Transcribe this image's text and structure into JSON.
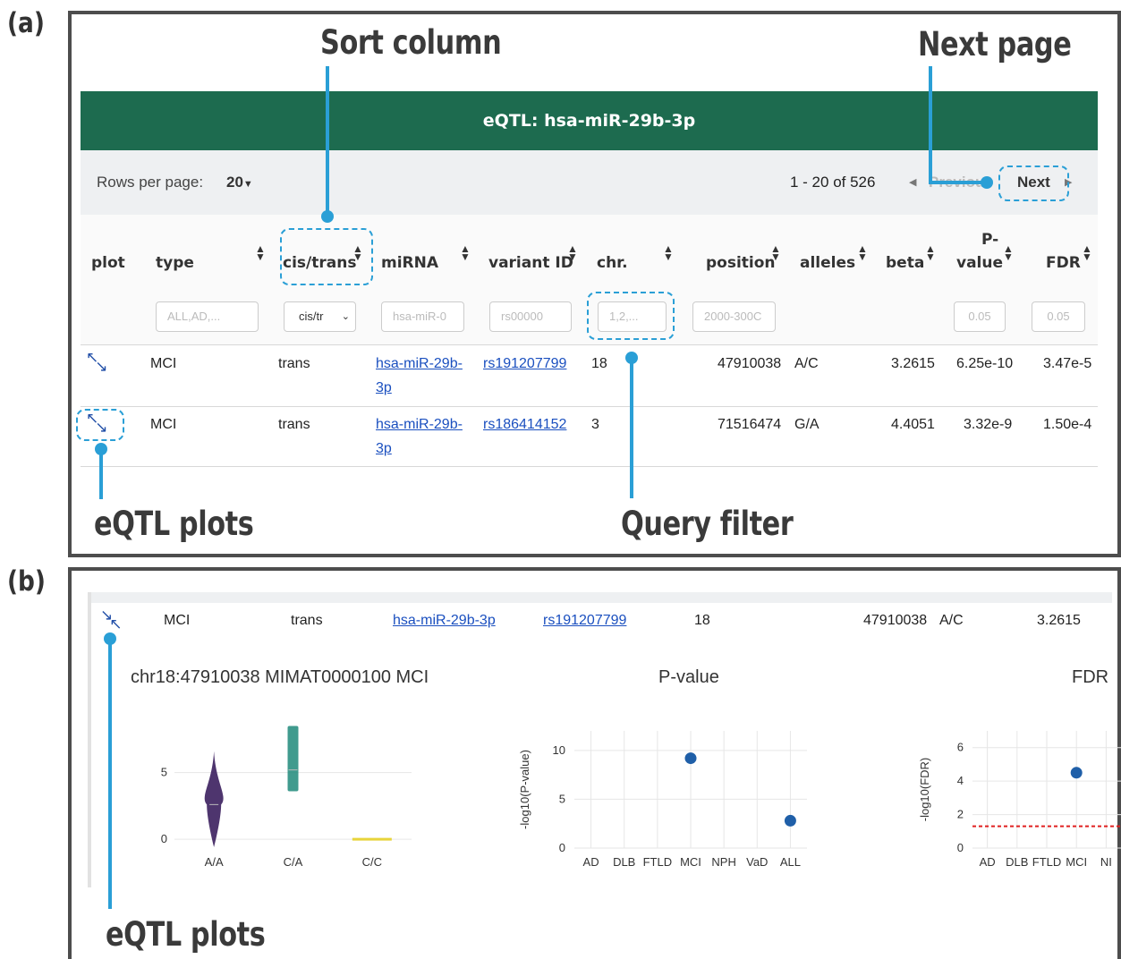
{
  "labels": {
    "panel_a": "(a)",
    "panel_b": "(b)"
  },
  "callouts": {
    "sort_column": "Sort column",
    "next_page": "Next page",
    "eqtl_plots_a": "eQTL plots",
    "query_filter": "Query filter",
    "eqtl_plots_b": "eQTL plots"
  },
  "table": {
    "title": "eQTL: hsa-miR-29b-3p",
    "rows_per_page_label": "Rows per page:",
    "rows_per_page_value": "20",
    "range_text": "1 - 20 of 526",
    "prev_label": "Previous",
    "next_label": "Next",
    "headers": {
      "plot": "plot",
      "type": "type",
      "cis_trans": "cis/trans",
      "mirna": "miRNA",
      "variant_id": "variant ID",
      "chr": "chr.",
      "position": "position",
      "alleles": "alleles",
      "beta": "beta",
      "pvalue_1": "P-",
      "pvalue_2": "value",
      "fdr": "FDR"
    },
    "filters": {
      "type": "ALL,AD,...",
      "cis_trans": "cis/tr",
      "mirna": "hsa-miR-0",
      "variant": "rs00000",
      "chr": "1,2,...",
      "position": "2000-300C",
      "pvalue": "0.05",
      "fdr": "0.05"
    },
    "rows": [
      {
        "type": "MCI",
        "cis": "trans",
        "mirna_1": "hsa-miR-29b-",
        "mirna_2": "3p",
        "variant": "rs191207799",
        "chr": "18",
        "position": "47910038",
        "alleles": "A/C",
        "beta": "3.2615",
        "pvalue": "6.25e-10",
        "fdr": "3.47e-5"
      },
      {
        "type": "MCI",
        "cis": "trans",
        "mirna_1": "hsa-miR-29b-",
        "mirna_2": "3p",
        "variant": "rs186414152",
        "chr": "3",
        "position": "71516474",
        "alleles": "G/A",
        "beta": "4.4051",
        "pvalue": "3.32e-9",
        "fdr": "1.50e-4"
      }
    ]
  },
  "expanded": {
    "row": {
      "type": "MCI",
      "cis": "trans",
      "mirna": "hsa-miR-29b-3p",
      "variant": "rs191207799",
      "chr": "18",
      "position": "47910038",
      "alleles": "A/C",
      "beta": "3.2615"
    },
    "plot_titles": {
      "violin": "chr18:47910038 MIMAT0000100 MCI",
      "pvalue": "P-value",
      "fdr": "FDR"
    }
  },
  "chart_data": [
    {
      "type": "violin",
      "title": "chr18:47910038 MIMAT0000100 MCI",
      "categories": [
        "A/A",
        "C/A",
        "C/C"
      ],
      "yticks": [
        0,
        5
      ],
      "ylim": [
        -0.8,
        8.6
      ],
      "groups": [
        {
          "name": "A/A",
          "min": -0.6,
          "q1": 2.0,
          "median": 2.6,
          "q3": 3.2,
          "max": 6.6,
          "color": "#3b1f5e"
        },
        {
          "name": "C/A",
          "min": 3.6,
          "q1": 3.9,
          "median": 5.2,
          "q3": 8.1,
          "max": 8.5,
          "color": "#1f8a7a"
        },
        {
          "name": "C/C",
          "min": 0.0,
          "q1": 0.0,
          "median": 0.0,
          "q3": 0.0,
          "max": 0.0,
          "color": "#e8d43a"
        }
      ]
    },
    {
      "type": "scatter",
      "title": "P-value",
      "ylabel": "-log10(P-value)",
      "categories": [
        "AD",
        "DLB",
        "FTLD",
        "MCI",
        "NPH",
        "VaD",
        "ALL"
      ],
      "points": [
        {
          "x": "MCI",
          "y": 9.2
        },
        {
          "x": "ALL",
          "y": 2.8
        }
      ],
      "yticks": [
        0,
        5,
        10
      ],
      "ylim": [
        0,
        12
      ],
      "color": "#1f5fa8"
    },
    {
      "type": "scatter",
      "title": "FDR",
      "ylabel": "-log10(FDR)",
      "categories": [
        "AD",
        "DLB",
        "FTLD",
        "MCI",
        "NI"
      ],
      "points": [
        {
          "x": "MCI",
          "y": 4.5
        }
      ],
      "yticks": [
        0,
        2,
        4,
        6
      ],
      "ylim": [
        0,
        7
      ],
      "threshold": 1.3,
      "threshold_color": "#e02020",
      "color": "#1f5fa8"
    }
  ]
}
